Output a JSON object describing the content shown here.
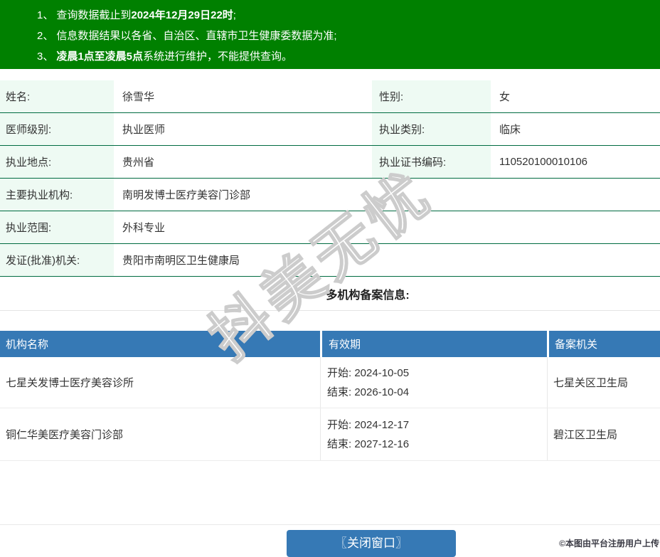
{
  "banner": {
    "items": [
      {
        "num": "1、",
        "pre": "查询数据截止到",
        "bold": "2024年12月29日22时",
        "post": ";"
      },
      {
        "num": "2、",
        "pre": "信息数据结果以各省、自治区、直辖市卫生健康委数据为准;",
        "bold": "",
        "post": ""
      },
      {
        "num": "3、",
        "pre": "",
        "bold": "凌晨1点至凌晨5点",
        "post": "系统进行维护，不能提供查询。"
      }
    ]
  },
  "profile": {
    "rows": [
      {
        "label": "姓名:",
        "value": "徐雪华",
        "label2": "性别:",
        "value2": "女"
      },
      {
        "label": "医师级别:",
        "value": "执业医师",
        "label2": "执业类别:",
        "value2": "临床"
      },
      {
        "label": "执业地点:",
        "value": "贵州省",
        "label2": "执业证书编码:",
        "value2": "110520100010106"
      },
      {
        "label": "主要执业机构:",
        "value": "南明发博士医疗美容门诊部"
      },
      {
        "label": "执业范围:",
        "value": "外科专业"
      },
      {
        "label": "发证(批准)机关:",
        "value": "贵阳市南明区卫生健康局"
      }
    ]
  },
  "section": {
    "heading": "多机构备案信息:"
  },
  "registry_table": {
    "headers": {
      "org": "机构名称",
      "validity": "有效期",
      "authority": "备案机关"
    },
    "rows": [
      {
        "org": "七星关发博士医疗美容诊所",
        "start": "开始: 2024-10-05",
        "end": "结束: 2026-10-04",
        "authority": "七星关区卫生局"
      },
      {
        "org": "铜仁华美医疗美容门诊部",
        "start": "开始: 2024-12-17",
        "end": "结束: 2027-12-16",
        "authority": "碧江区卫生局"
      }
    ]
  },
  "footer": {
    "close_button": "〖关闭窗口〗",
    "credit": "©本图由平台注册用户上传"
  },
  "watermark": {
    "text": "抖美无忧"
  },
  "colors": {
    "banner_green": "#008000",
    "row_border_green": "#006b41",
    "label_bg": "#eefaf3",
    "header_blue": "#3679b5"
  }
}
